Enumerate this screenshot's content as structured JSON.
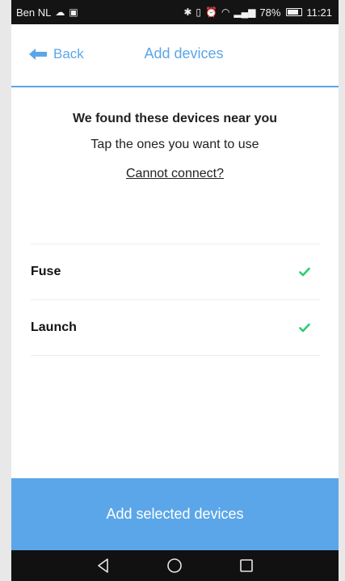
{
  "status_bar": {
    "carrier": "Ben NL",
    "battery_percent": "78%",
    "time": "11:21"
  },
  "nav": {
    "back_label": "Back",
    "title": "Add devices"
  },
  "intro": {
    "heading": "We found these devices near you",
    "subtitle": "Tap the ones you want to use",
    "help_link": "Cannot connect?"
  },
  "devices": [
    {
      "name": "Fuse",
      "selected": true
    },
    {
      "name": "Launch",
      "selected": true
    }
  ],
  "primary_button": {
    "label": "Add selected devices"
  },
  "colors": {
    "accent": "#5ba6e8",
    "check": "#2ecc71",
    "divider": "#ececec"
  },
  "icons": {
    "back": "arrow-left-icon",
    "check": "check-icon",
    "android_back": "triangle-back-icon",
    "android_home": "circle-home-icon",
    "android_recents": "square-recents-icon"
  }
}
